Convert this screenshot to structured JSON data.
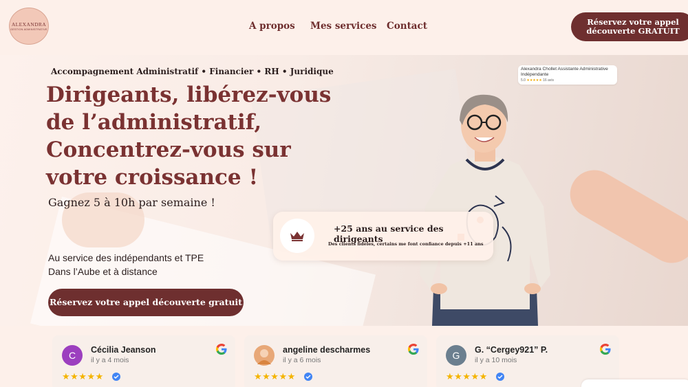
{
  "header": {
    "logo_name": "ALEXANDRA",
    "logo_subtitle": "GESTION ADMINISTRATIVE",
    "nav": [
      "A propos",
      "Mes services",
      "Contact"
    ],
    "cta_line1": "Réservez votre appel",
    "cta_line2": "découverte GRATUIT"
  },
  "hero": {
    "subtag": "Accompagnement Administratif • Financier • RH • Juridique",
    "headline": [
      "Dirigeants, libérez-vous",
      "de l’administratif,",
      "Concentrez-vous sur",
      "votre croissance !"
    ],
    "gain": "Gagnez 5 à 10h par semaine !",
    "serve_line1": "Au service des indépendants et TPE",
    "serve_line2": "Dans l’Aube et à distance",
    "cta": "Réservez votre appel découverte gratuit",
    "review_widget": {
      "name": "Alexandra Chollet Assistante Administrative Indépendante",
      "rating": "5.0",
      "stars": "★★★★★",
      "count": "16 avis"
    },
    "stat": {
      "title": "+25 ans au service des dirigeants",
      "subtitle": "Des clients fidèles, certains me font confiance depuis +11 ans",
      "icon": "crown-icon"
    }
  },
  "reviews": [
    {
      "initial": "C",
      "name": "Cécilia Jeanson",
      "date": "il y a 4 mois",
      "stars": "★★★★★",
      "avatar_color": "#9c3fbf"
    },
    {
      "initial": "",
      "name": "angeline descharmes",
      "date": "il y a 6 mois",
      "stars": "★★★★★",
      "avatar_color": "#e8a878"
    },
    {
      "initial": "G",
      "name": "G. “Cergey921” P.",
      "date": "il y a 10 mois",
      "stars": "★★★★★",
      "avatar_color": "#6b7f8f"
    }
  ],
  "colors": {
    "brand": "#6e2f2f",
    "headline": "#7a3232",
    "background": "#fdf0ea"
  }
}
